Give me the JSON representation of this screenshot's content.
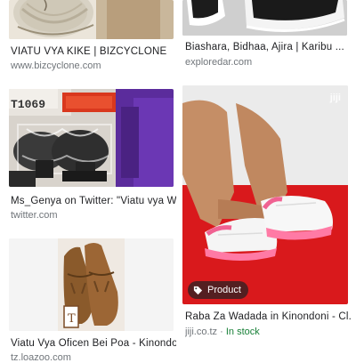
{
  "results": [
    {
      "title": "VIATU VYA KIKE | BIZCYCLONE",
      "source": "www.bizcyclone.com"
    },
    {
      "title": "Biashara, Bidhaa, Ajira | Karibu ...",
      "source": "exploredar.com"
    },
    {
      "title": "Ms_Genya on Twitter: \"Viatu vya W...",
      "source": "twitter.com",
      "box_label": "T1069"
    },
    {
      "title": "Raba Za Wadada in Kinondoni - Cl...",
      "source": "jiji.co.tz",
      "source_separator": " · ",
      "stock": "In stock",
      "badge": "Product",
      "watermark": "jiji"
    },
    {
      "title": "Viatu Vya Oficen Bei Poa - Kinondo...",
      "source": "tz.loazoo.com"
    }
  ],
  "colors": {
    "title": "#202124",
    "source": "#70757a",
    "in_stock": "#188038",
    "badge_bg": "#202124"
  },
  "icons": {
    "badge": "tag-icon"
  }
}
